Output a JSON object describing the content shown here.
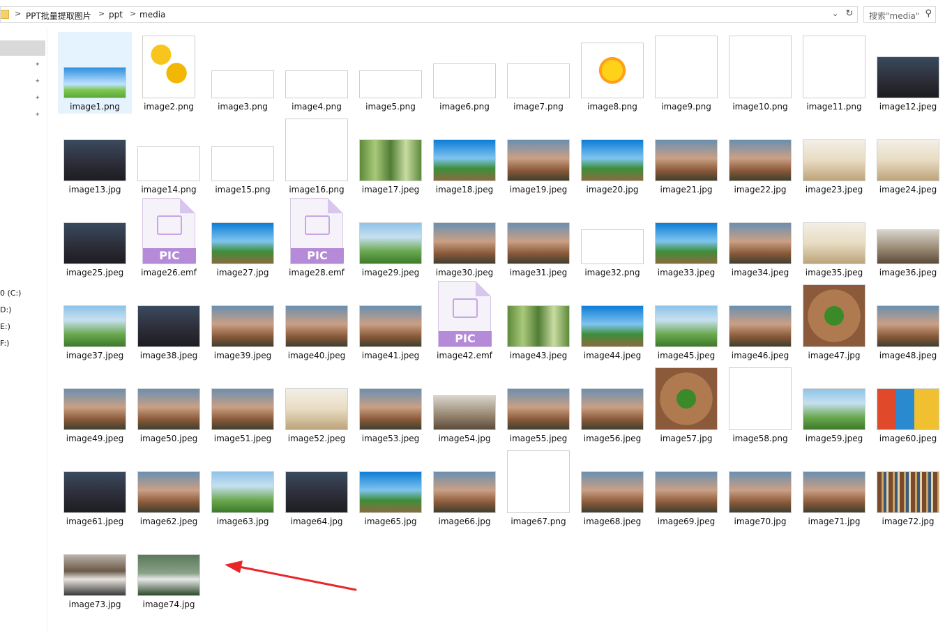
{
  "address_bar": {
    "breadcrumbs": [
      "PPT批量提取图片",
      "ppt",
      "media"
    ],
    "chevron": ">",
    "dropdown_icon": "chevron-down-icon",
    "refresh_icon": "refresh-icon"
  },
  "search": {
    "placeholder": "搜索\"media\"",
    "icon": "search-icon"
  },
  "navigation": {
    "pin_icon": "pin-icon",
    "drives": [
      "0 (C:)",
      "D:)",
      "E:)",
      "F:)"
    ]
  },
  "files": [
    {
      "name": "image1.png",
      "kind": "sky",
      "selected": true
    },
    {
      "name": "image2.png",
      "kind": "flower"
    },
    {
      "name": "image3.png",
      "kind": "text-g"
    },
    {
      "name": "image4.png",
      "kind": "text-g"
    },
    {
      "name": "image5.png",
      "kind": "text-g"
    },
    {
      "name": "image6.png",
      "kind": "white"
    },
    {
      "name": "image7.png",
      "kind": "white"
    },
    {
      "name": "image8.png",
      "kind": "sun"
    },
    {
      "name": "image9.png",
      "kind": "kid"
    },
    {
      "name": "image10.png",
      "kind": "kid"
    },
    {
      "name": "image11.png",
      "kind": "kid"
    },
    {
      "name": "image12.jpeg",
      "kind": "crowd"
    },
    {
      "name": "image13.jpg",
      "kind": "crowd"
    },
    {
      "name": "image14.png",
      "kind": "white"
    },
    {
      "name": "image15.png",
      "kind": "white"
    },
    {
      "name": "image16.png",
      "kind": "frames"
    },
    {
      "name": "image17.jpeg",
      "kind": "bamboo"
    },
    {
      "name": "image18.jpeg",
      "kind": "trees"
    },
    {
      "name": "image19.jpeg",
      "kind": "people"
    },
    {
      "name": "image20.jpg",
      "kind": "trees"
    },
    {
      "name": "image21.jpg",
      "kind": "people"
    },
    {
      "name": "image22.jpg",
      "kind": "people"
    },
    {
      "name": "image23.jpeg",
      "kind": "book"
    },
    {
      "name": "image24.jpeg",
      "kind": "book"
    },
    {
      "name": "image25.jpeg",
      "kind": "crowd"
    },
    {
      "name": "image26.emf",
      "kind": "emf"
    },
    {
      "name": "image27.jpg",
      "kind": "trees"
    },
    {
      "name": "image28.emf",
      "kind": "emf"
    },
    {
      "name": "image29.jpeg",
      "kind": "green"
    },
    {
      "name": "image30.jpeg",
      "kind": "people"
    },
    {
      "name": "image31.jpeg",
      "kind": "people"
    },
    {
      "name": "image32.png",
      "kind": "white"
    },
    {
      "name": "image33.jpeg",
      "kind": "trees"
    },
    {
      "name": "image34.jpeg",
      "kind": "people"
    },
    {
      "name": "image35.jpeg",
      "kind": "book"
    },
    {
      "name": "image36.jpeg",
      "kind": "desk"
    },
    {
      "name": "image37.jpeg",
      "kind": "green"
    },
    {
      "name": "image38.jpeg",
      "kind": "crowd"
    },
    {
      "name": "image39.jpeg",
      "kind": "people"
    },
    {
      "name": "image40.jpeg",
      "kind": "people"
    },
    {
      "name": "image41.jpeg",
      "kind": "people"
    },
    {
      "name": "image42.emf",
      "kind": "emf"
    },
    {
      "name": "image43.jpeg",
      "kind": "bamboo"
    },
    {
      "name": "image44.jpeg",
      "kind": "trees"
    },
    {
      "name": "image45.jpeg",
      "kind": "green"
    },
    {
      "name": "image46.jpeg",
      "kind": "people"
    },
    {
      "name": "image47.jpg",
      "kind": "hands"
    },
    {
      "name": "image48.jpeg",
      "kind": "people"
    },
    {
      "name": "image49.jpeg",
      "kind": "people"
    },
    {
      "name": "image50.jpeg",
      "kind": "people"
    },
    {
      "name": "image51.jpeg",
      "kind": "people"
    },
    {
      "name": "image52.jpeg",
      "kind": "book"
    },
    {
      "name": "image53.jpeg",
      "kind": "people"
    },
    {
      "name": "image54.jpg",
      "kind": "desk"
    },
    {
      "name": "image55.jpeg",
      "kind": "people"
    },
    {
      "name": "image56.jpeg",
      "kind": "people"
    },
    {
      "name": "image57.jpg",
      "kind": "hands"
    },
    {
      "name": "image58.png",
      "kind": "frames"
    },
    {
      "name": "image59.jpeg",
      "kind": "green"
    },
    {
      "name": "image60.jpeg",
      "kind": "wall"
    },
    {
      "name": "image61.jpeg",
      "kind": "crowd"
    },
    {
      "name": "image62.jpeg",
      "kind": "people"
    },
    {
      "name": "image63.jpg",
      "kind": "green"
    },
    {
      "name": "image64.jpg",
      "kind": "crowd"
    },
    {
      "name": "image65.jpg",
      "kind": "trees"
    },
    {
      "name": "image66.jpg",
      "kind": "people"
    },
    {
      "name": "image67.png",
      "kind": "frames"
    },
    {
      "name": "image68.jpeg",
      "kind": "people"
    },
    {
      "name": "image69.jpeg",
      "kind": "people"
    },
    {
      "name": "image70.jpg",
      "kind": "people"
    },
    {
      "name": "image71.jpg",
      "kind": "people"
    },
    {
      "name": "image72.jpg",
      "kind": "library"
    },
    {
      "name": "image73.jpg",
      "kind": "classroom"
    },
    {
      "name": "image74.jpg",
      "kind": "stack"
    }
  ],
  "emf_badge": "PIC",
  "annotation": {
    "shape": "red-arrow",
    "color": "#e8262a"
  },
  "colors": {
    "selection": "#e5f3ff",
    "nav_selection": "#d9d9d9",
    "border": "#d9d9d9"
  }
}
